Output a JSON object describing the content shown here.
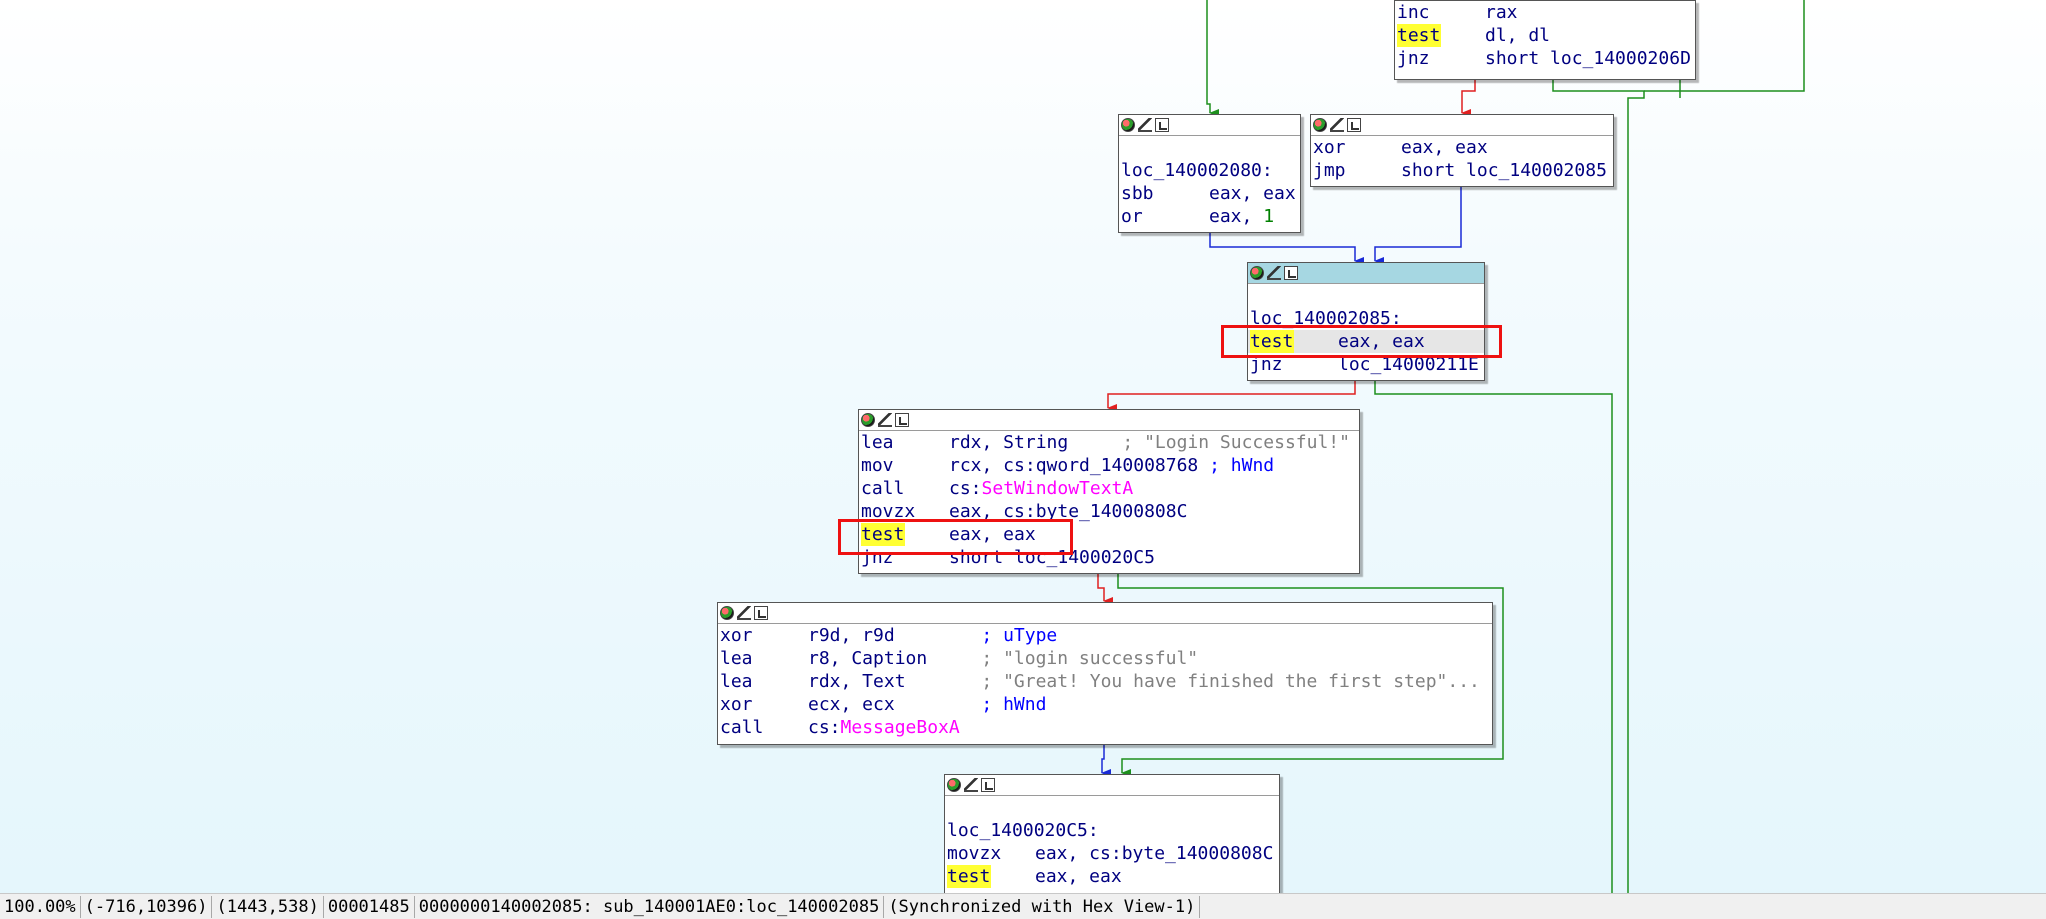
{
  "view": {
    "blocks": [
      {
        "id": "b1",
        "lines": [
          {
            "mnem": "inc",
            "ops": "rax"
          },
          {
            "mnem": "test",
            "ops": "dl, dl",
            "hl": true
          },
          {
            "mnem": "jnz",
            "ops": "short loc_14000206D"
          }
        ]
      },
      {
        "id": "b2",
        "label": "loc_140002080:",
        "lines": [
          {
            "mnem": "sbb",
            "ops": "eax, eax"
          },
          {
            "mnem": "or",
            "ops": "eax, ",
            "num": "1"
          }
        ]
      },
      {
        "id": "b3",
        "lines": [
          {
            "mnem": "xor",
            "ops": "eax, eax"
          },
          {
            "mnem": "jmp",
            "ops": "short loc_140002085"
          }
        ]
      },
      {
        "id": "b4",
        "label": "loc_140002085:",
        "lines": [
          {
            "mnem": "test",
            "ops": "eax, eax",
            "hl": true
          },
          {
            "mnem": "jnz",
            "ops": "loc_14000211E"
          }
        ]
      },
      {
        "id": "b5",
        "lines": [
          {
            "mnem": "lea",
            "ops": "rdx, String     ",
            "str": "; \"Login Successful!\""
          },
          {
            "mnem": "mov",
            "ops": "rcx, cs:qword_140008768 ",
            "cmt": "; hWnd"
          },
          {
            "mnem": "call",
            "ops": "cs:",
            "imp": "SetWindowTextA"
          },
          {
            "mnem": "movzx",
            "ops": "eax, cs:byte_14000808C"
          },
          {
            "mnem": "test",
            "ops": "eax, eax",
            "hl": true
          },
          {
            "mnem": "jnz",
            "ops": "short loc_1400020C5"
          }
        ]
      },
      {
        "id": "b6",
        "lines": [
          {
            "mnem": "xor",
            "ops": "r9d, r9d        ",
            "cmt": "; uType"
          },
          {
            "mnem": "lea",
            "ops": "r8, Caption     ",
            "str": "; \"login successful\""
          },
          {
            "mnem": "lea",
            "ops": "rdx, Text       ",
            "str": "; \"Great! You have finished the first step\"..."
          },
          {
            "mnem": "xor",
            "ops": "ecx, ecx        ",
            "cmt": "; hWnd"
          },
          {
            "mnem": "call",
            "ops": "cs:",
            "imp": "MessageBoxA"
          }
        ]
      },
      {
        "id": "b7",
        "label": "loc_1400020C5:",
        "lines": [
          {
            "mnem": "movzx",
            "ops": "eax, cs:byte_14000808C"
          },
          {
            "mnem": "test",
            "ops": "eax, eax",
            "hl": true
          }
        ]
      }
    ]
  },
  "status_bar": {
    "zoom": "100.00%",
    "graph_coords": "(-716,10396)",
    "mouse_coords": "(1443,538)",
    "file_offset": "00001485",
    "location": "0000000140002085: sub_140001AE0:loc_140002085",
    "sync": "(Synchronized with Hex View-1)"
  },
  "colors": {
    "edge_true": "#1d8f1d",
    "edge_false": "#e02020",
    "edge_uncond": "#1a2bd6",
    "highlight": "#ffff33",
    "imported_fn": "#ff00ff",
    "annotation_box": "#ee1111"
  },
  "icons": {
    "header": [
      "color-icon",
      "rename-icon",
      "graph-icon"
    ]
  }
}
